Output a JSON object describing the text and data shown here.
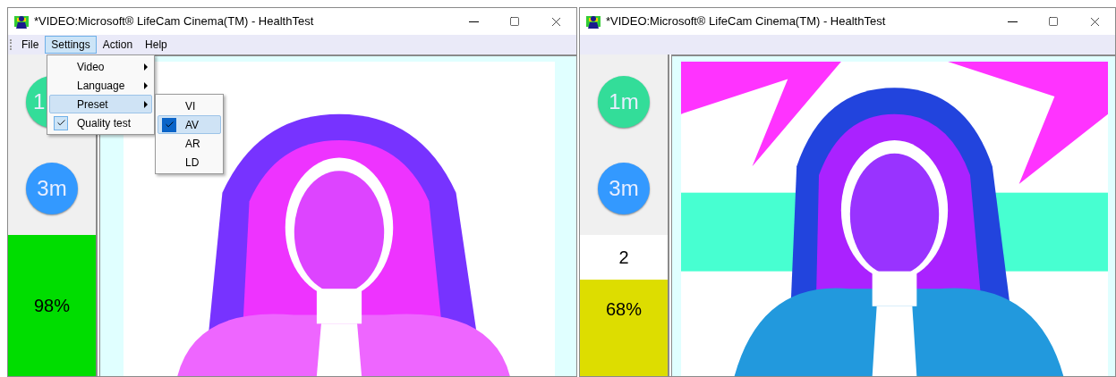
{
  "windows": [
    {
      "title": "*VIDEO:Microsoft® LifeCam Cinema(TM) - HealthTest",
      "menu": [
        {
          "label": "File",
          "selected": false
        },
        {
          "label": "Settings",
          "selected": true
        },
        {
          "label": "Action",
          "selected": false
        },
        {
          "label": "Help",
          "selected": false
        }
      ],
      "dropdown": {
        "items": [
          {
            "label": "Video",
            "kind": "submenu",
            "checked": false,
            "selected": false
          },
          {
            "label": "Language",
            "kind": "submenu",
            "checked": false,
            "selected": false
          },
          {
            "label": "Preset",
            "kind": "submenu",
            "checked": false,
            "selected": true
          },
          {
            "label": "Quality test",
            "kind": "command",
            "checked": true,
            "selected": false
          }
        ],
        "submenu": [
          {
            "label": "VI",
            "checked": false,
            "selected": false
          },
          {
            "label": "AV",
            "checked": true,
            "selected": true
          },
          {
            "label": "AR",
            "checked": false,
            "selected": false
          },
          {
            "label": "LD",
            "checked": false,
            "selected": false
          }
        ]
      },
      "timers": [
        {
          "label": "1",
          "color": "#33dd99"
        },
        {
          "label": "3m",
          "color": "#3399ff"
        }
      ],
      "score": {
        "text": "98%",
        "color": "#00dd00"
      }
    },
    {
      "title": "*VIDEO:Microsoft® LifeCam Cinema(TM) - HealthTest",
      "timers": [
        {
          "label": "1m",
          "color": "#33dd99"
        },
        {
          "label": "3m",
          "color": "#3399ff"
        }
      ],
      "count": "2",
      "score": {
        "text": "68%",
        "color": "#dddd00"
      }
    }
  ]
}
